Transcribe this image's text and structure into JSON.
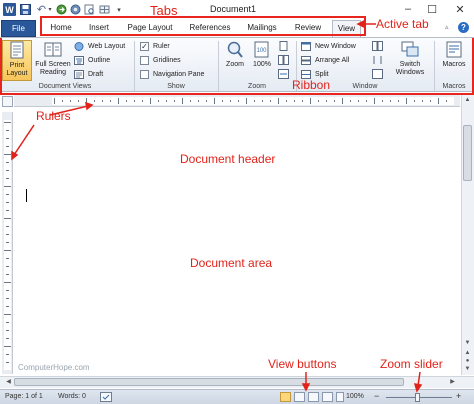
{
  "titlebar": {
    "document_title": "Document1",
    "logo_letter": "W",
    "minimize": "–",
    "maximize": "☐",
    "close": "✕"
  },
  "tabs": {
    "file": "File",
    "home": "Home",
    "insert": "Insert",
    "page_layout": "Page Layout",
    "references": "References",
    "mailings": "Mailings",
    "review": "Review",
    "view": "View",
    "active": "View"
  },
  "ribbon": {
    "document_views": {
      "label": "Document Views",
      "print_layout": "Print Layout",
      "full_screen_reading": "Full Screen Reading",
      "web_layout": "Web Layout",
      "outline": "Outline",
      "draft": "Draft"
    },
    "show": {
      "label": "Show",
      "ruler": "Ruler",
      "ruler_checked": true,
      "gridlines": "Gridlines",
      "gridlines_checked": false,
      "navigation_pane": "Navigation Pane",
      "navigation_pane_checked": false
    },
    "zoom": {
      "label": "Zoom",
      "zoom": "Zoom",
      "hundred": "100%"
    },
    "window": {
      "label": "Window",
      "new_window": "New Window",
      "arrange_all": "Arrange All",
      "split": "Split",
      "switch_windows": "Switch Windows"
    },
    "macros": {
      "label": "Macros",
      "macros": "Macros"
    }
  },
  "statusbar": {
    "page": "Page: 1 of 1",
    "words": "Words: 0",
    "zoom_percent": "100%",
    "zoom_level": 1.0
  },
  "watermark": "ComputerHope.com",
  "annotations": {
    "tabs": "Tabs",
    "active_tab": "Active tab",
    "ribbon": "Ribbon",
    "rulers": "Rulers",
    "document_header": "Document header",
    "document_area": "Document area",
    "view_buttons": "View buttons",
    "zoom_slider": "Zoom slider"
  },
  "colors": {
    "file_tab": "#2a579a",
    "annotation": "#e2231a",
    "print_layout_active": "#f8c55a"
  }
}
